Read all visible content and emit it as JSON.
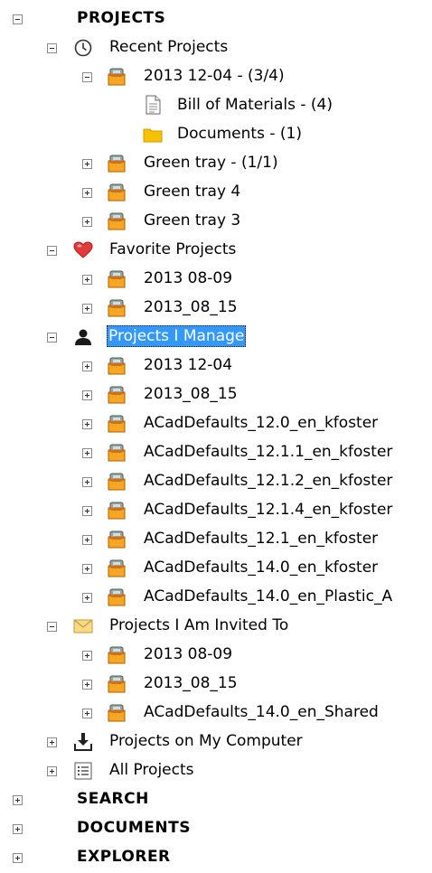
{
  "tree": {
    "projects": {
      "label": "PROJECTS",
      "recent": {
        "label": "Recent Projects",
        "items": [
          {
            "label": "2013 12-04 - (3/4)",
            "children": [
              "Bill of Materials - (4)",
              "Documents - (1)"
            ]
          },
          {
            "label": "Green tray - (1/1)"
          },
          {
            "label": "Green tray 4"
          },
          {
            "label": "Green tray 3"
          }
        ]
      },
      "favorite": {
        "label": "Favorite Projects",
        "items": [
          "2013 08-09",
          "2013_08_15"
        ]
      },
      "manage": {
        "label": "Projects I Manage",
        "items": [
          "2013 12-04",
          "2013_08_15",
          "ACadDefaults_12.0_en_kfoster",
          "ACadDefaults_12.1.1_en_kfoster",
          "ACadDefaults_12.1.2_en_kfoster",
          "ACadDefaults_12.1.4_en_kfoster",
          "ACadDefaults_12.1_en_kfoster",
          "ACadDefaults_14.0_en_kfoster",
          "ACadDefaults_14.0_en_Plastic_A"
        ]
      },
      "invited": {
        "label": "Projects I Am Invited To",
        "items": [
          "2013 08-09",
          "2013_08_15",
          "ACadDefaults_14.0_en_Shared"
        ]
      },
      "computer": {
        "label": "Projects on My Computer"
      },
      "all": {
        "label": "All Projects"
      }
    },
    "search": {
      "label": "SEARCH"
    },
    "documents": {
      "label": "DOCUMENTS"
    },
    "explorer": {
      "label": "EXPLORER"
    }
  }
}
